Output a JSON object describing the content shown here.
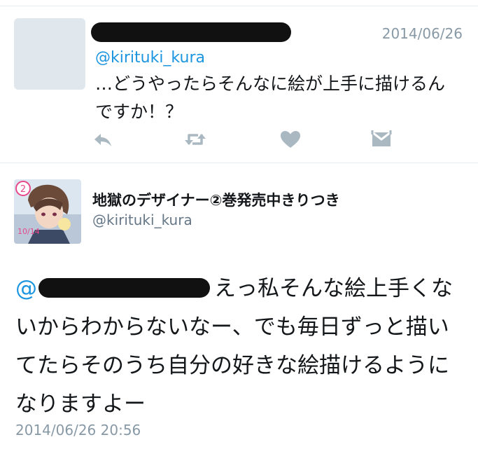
{
  "tweet1": {
    "handle": "@kirituki_kura",
    "date": "2014/06/26",
    "text": "…どうやったらそんなに絵が上手に描けるんですか！？"
  },
  "tweet2": {
    "display_name": "地獄のデザイナー②巻発売中きりつき",
    "handle": "@kirituki_kura",
    "mention_prefix": "@",
    "text": "えっ私そんな絵上手くないからわからないなー、でも毎日ずっと描いてたらそのうち自分の好きな絵描けるようになりますよー",
    "timestamp": "2014/06/26 20:56"
  },
  "icons": {
    "reply": "reply-icon",
    "retweet": "retweet-icon",
    "like": "heart-icon",
    "dm": "direct-message-icon"
  },
  "colors": {
    "link": "#1b95e0",
    "icon": "#aab8c2",
    "meta": "#8899a6"
  }
}
